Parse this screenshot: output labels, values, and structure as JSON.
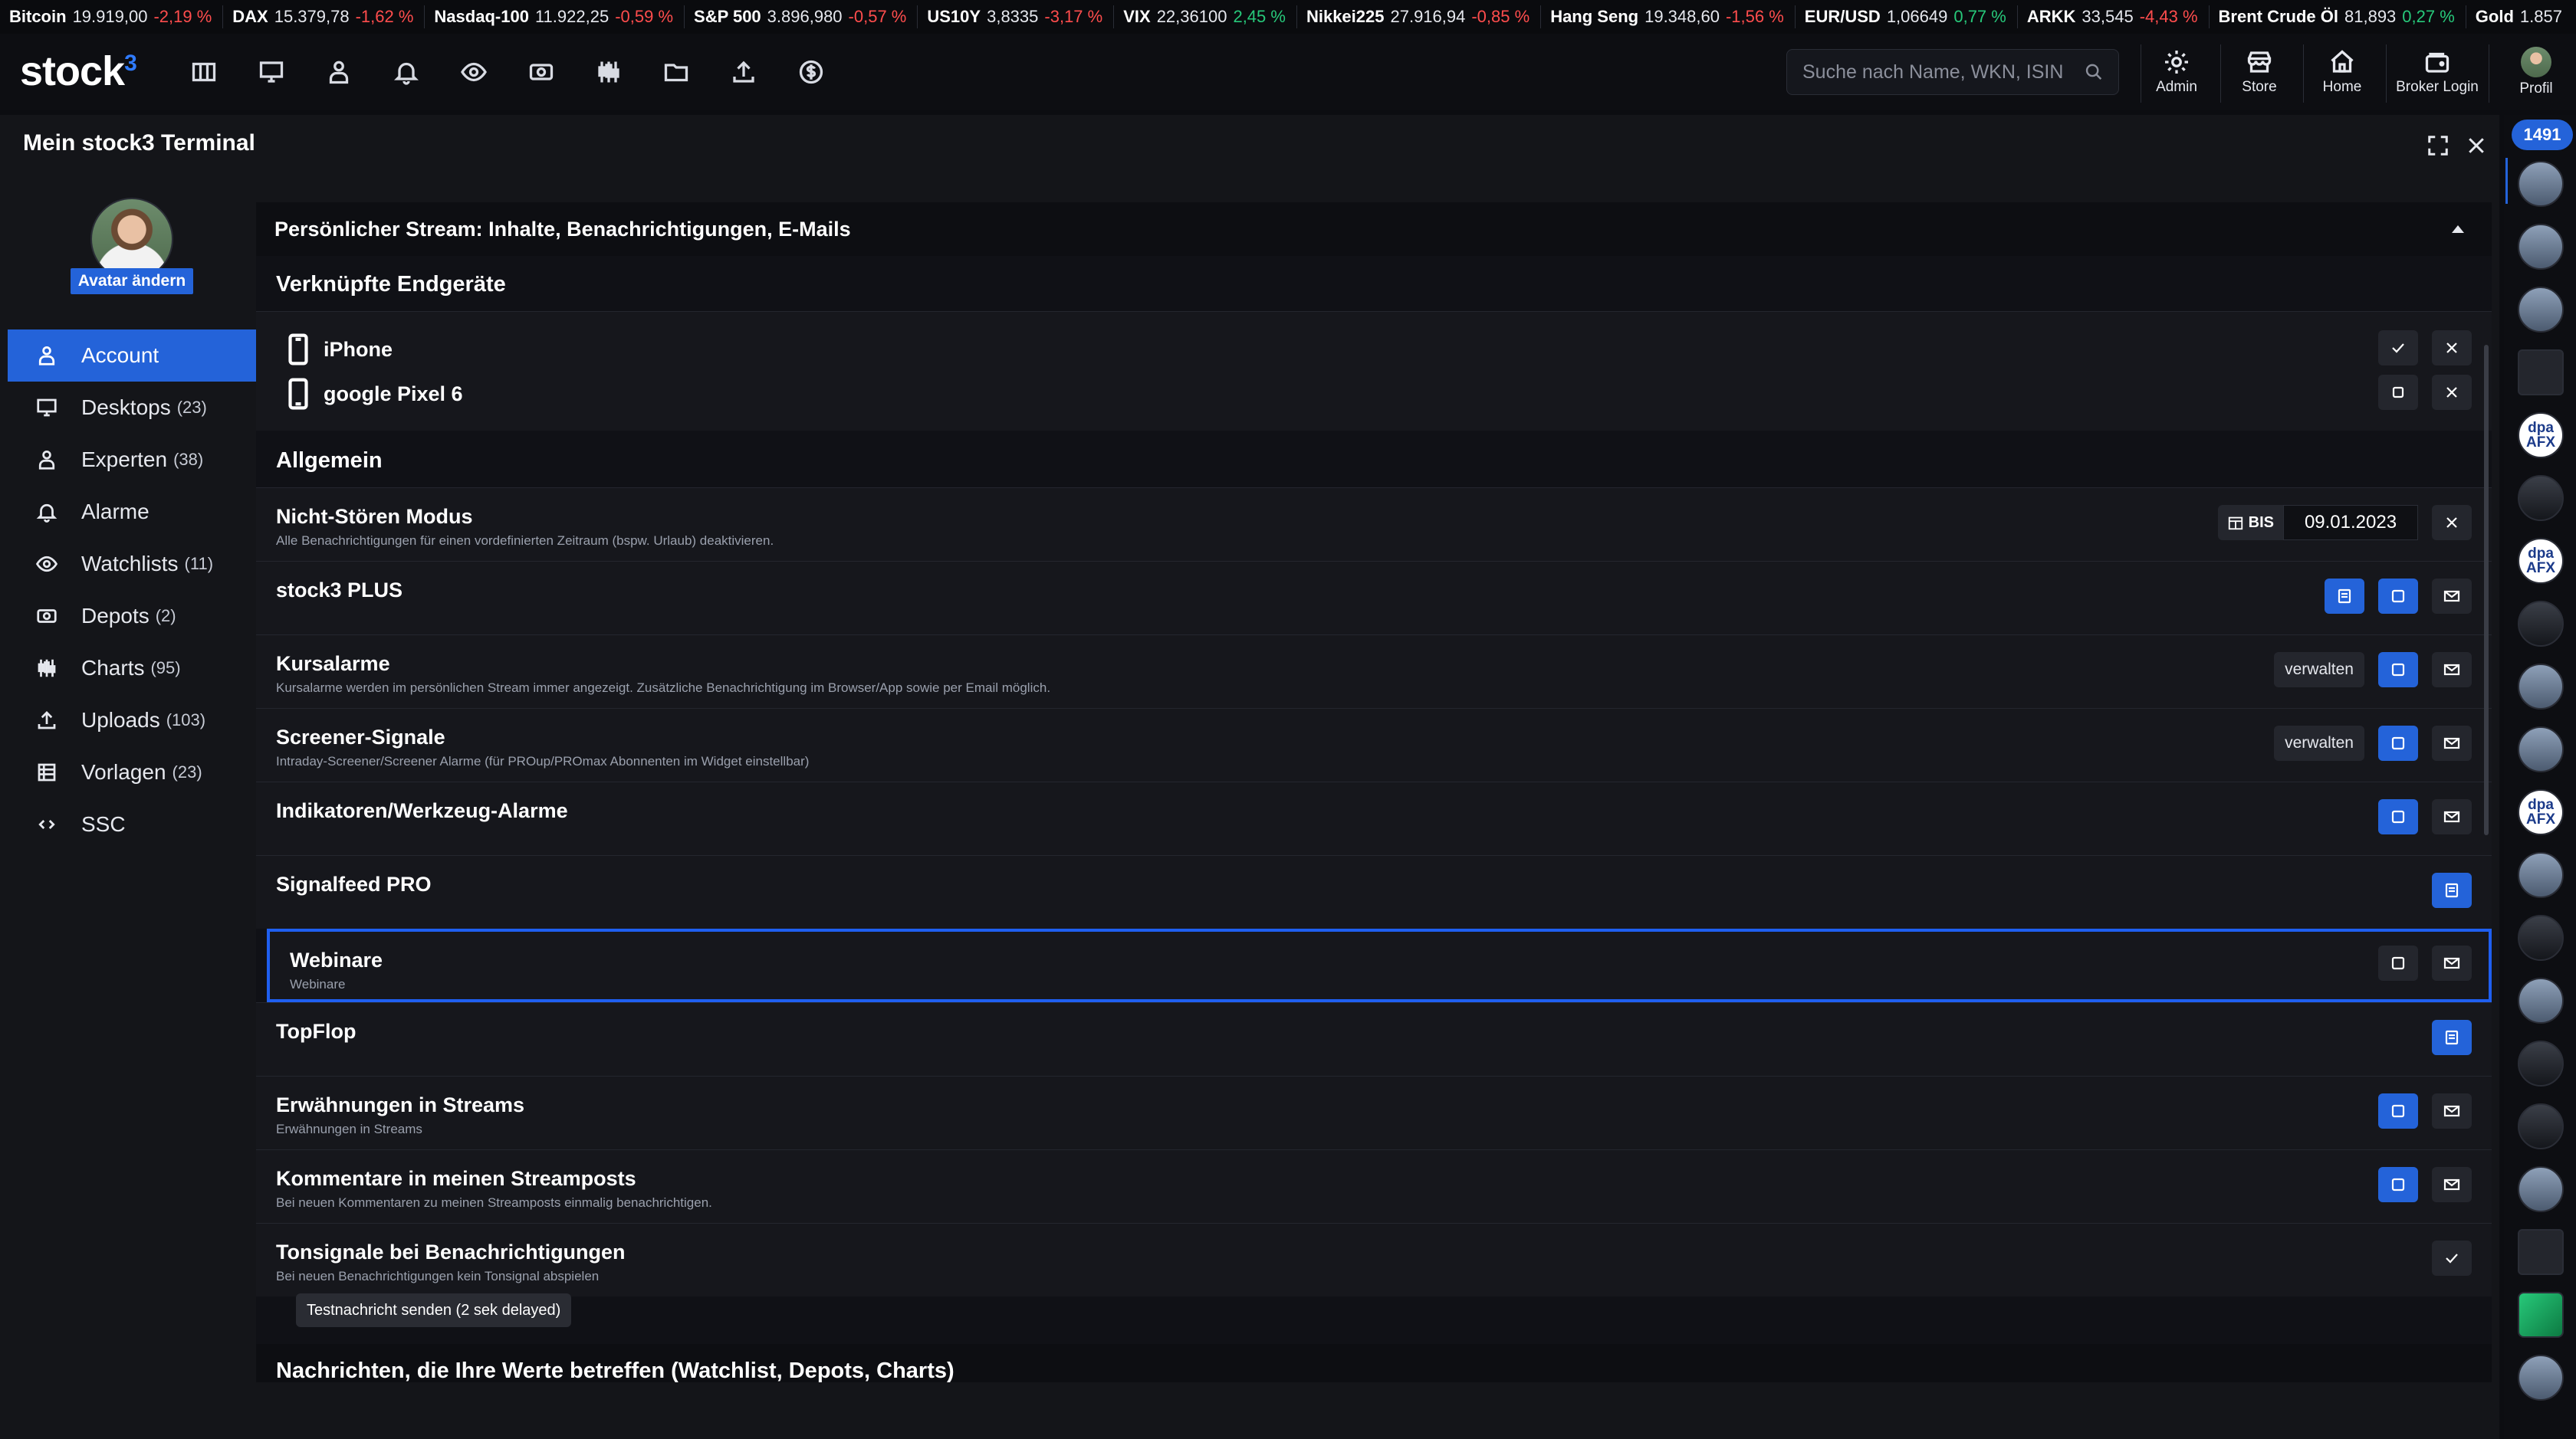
{
  "ticker": [
    {
      "name": "Bitcoin",
      "value": "19.919,00",
      "change": "-2,19 %",
      "dir": "neg"
    },
    {
      "name": "DAX",
      "value": "15.379,78",
      "change": "-1,62 %",
      "dir": "neg"
    },
    {
      "name": "Nasdaq-100",
      "value": "11.922,25",
      "change": "-0,59 %",
      "dir": "neg"
    },
    {
      "name": "S&P 500",
      "value": "3.896,980",
      "change": "-0,57 %",
      "dir": "neg"
    },
    {
      "name": "US10Y",
      "value": "3,8335",
      "change": "-3,17 %",
      "dir": "neg"
    },
    {
      "name": "VIX",
      "value": "22,36100",
      "change": "2,45 %",
      "dir": "pos"
    },
    {
      "name": "Nikkei225",
      "value": "27.916,94",
      "change": "-0,85 %",
      "dir": "neg"
    },
    {
      "name": "Hang Seng",
      "value": "19.348,60",
      "change": "-1,56 %",
      "dir": "neg"
    },
    {
      "name": "EUR/USD",
      "value": "1,06649",
      "change": "0,77 %",
      "dir": "pos"
    },
    {
      "name": "ARKK",
      "value": "33,545",
      "change": "-4,43 %",
      "dir": "neg"
    },
    {
      "name": "Brent Crude Öl",
      "value": "81,893",
      "change": "0,27 %",
      "dir": "pos"
    },
    {
      "name": "Gold",
      "value": "1.857",
      "change": "",
      "dir": "pos"
    }
  ],
  "header": {
    "logo": "stock",
    "logo_sup": "3",
    "search_placeholder": "Suche nach Name, WKN, ISIN",
    "buttons": {
      "admin": "Admin",
      "store": "Store",
      "home": "Home",
      "broker": "Broker Login",
      "profile": "Profil"
    }
  },
  "panel": {
    "title": "Mein stock3 Terminal",
    "avatar_button": "Avatar ändern"
  },
  "sidenav": [
    {
      "label": "Account",
      "count": ""
    },
    {
      "label": "Desktops",
      "count": "(23)"
    },
    {
      "label": "Experten",
      "count": "(38)"
    },
    {
      "label": "Alarme",
      "count": ""
    },
    {
      "label": "Watchlists",
      "count": "(11)"
    },
    {
      "label": "Depots",
      "count": "(2)"
    },
    {
      "label": "Charts",
      "count": "(95)"
    },
    {
      "label": "Uploads",
      "count": "(103)"
    },
    {
      "label": "Vorlagen",
      "count": "(23)"
    },
    {
      "label": "SSC",
      "count": ""
    }
  ],
  "content": {
    "stream_header": "Persönlicher Stream: Inhalte, Benachrichtigungen, E-Mails",
    "devices_header": "Verknüpfte Endgeräte",
    "devices": [
      "iPhone",
      "google Pixel 6"
    ],
    "general_header": "Allgemein",
    "rows": [
      {
        "title": "Nicht-Stören Modus",
        "desc": "Alle Benachrichtigungen für einen vordefinierten Zeitraum (bspw. Urlaub) deaktivieren."
      },
      {
        "title": "stock3 PLUS",
        "desc": ""
      },
      {
        "title": "Kursalarme",
        "desc": "Kursalarme werden im persönlichen Stream immer angezeigt. Zusätzliche Benachrichtigung im Browser/App sowie per Email möglich."
      },
      {
        "title": "Screener-Signale",
        "desc": "Intraday-Screener/Screener Alarme (für PROup/PROmax Abonnenten im Widget einstellbar)"
      },
      {
        "title": "Indikatoren/Werkzeug-Alarme",
        "desc": ""
      },
      {
        "title": "Signalfeed PRO",
        "desc": ""
      },
      {
        "title": "Webinare",
        "desc": "Webinare"
      },
      {
        "title": "TopFlop",
        "desc": ""
      },
      {
        "title": "Erwähnungen in Streams",
        "desc": "Erwähnungen in Streams"
      },
      {
        "title": "Kommentare in meinen Streamposts",
        "desc": "Bei neuen Kommentaren zu meinen Streamposts einmalig benachrichtigen."
      },
      {
        "title": "Tonsignale bei Benachrichtigungen",
        "desc": "Bei neuen Benachrichtigungen kein Tonsignal abspielen"
      }
    ],
    "dnd_label": "BIS",
    "dnd_date": "09.01.2023",
    "manage_label": "verwalten",
    "tooltip": "Testnachricht senden (2 sek delayed)",
    "news_header": "Nachrichten, die Ihre Werte betreffen (Watchlist, Depots, Charts)"
  },
  "strip": {
    "count": "1491",
    "dpa": "dpa AFX"
  },
  "colors": {
    "accent": "#2463d9",
    "negative": "#ff4d4d",
    "positive": "#27c97a",
    "focus": "#1f5ff0"
  }
}
